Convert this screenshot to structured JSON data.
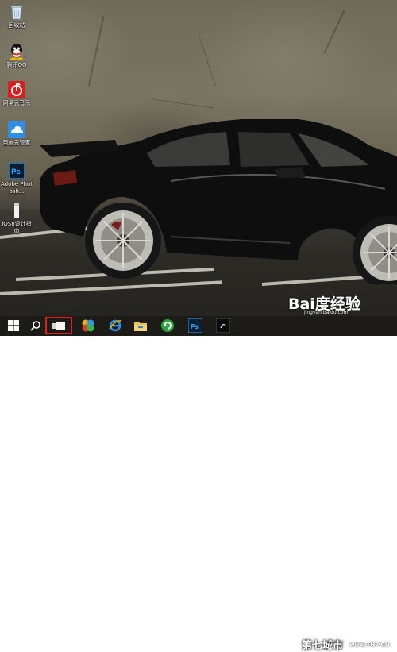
{
  "desktop": {
    "icons": [
      {
        "name": "recycle-bin-icon",
        "label": "回收站"
      },
      {
        "name": "qq-icon",
        "label": "腾讯QQ"
      },
      {
        "name": "netease-music-icon",
        "label": "网易云音乐"
      },
      {
        "name": "baidu-cloud-icon",
        "label": "百度云管家"
      },
      {
        "name": "photoshop-icon",
        "label": "Adobe Photosh..."
      },
      {
        "name": "ios8-design-file-icon",
        "label": "iOS8设计指南"
      }
    ]
  },
  "taskbar": {
    "items": [
      {
        "name": "start-windows-icon"
      },
      {
        "name": "search-icon"
      },
      {
        "name": "task-view-icon",
        "selected": true
      },
      {
        "name": "app-colorful-icon"
      },
      {
        "name": "internet-explorer-icon"
      },
      {
        "name": "file-explorer-icon"
      },
      {
        "name": "green-refresh-app-icon"
      },
      {
        "name": "photoshop-taskbar-icon",
        "label": "Ps"
      },
      {
        "name": "media-app-icon"
      }
    ],
    "selected_color": "#e0201b"
  },
  "watermarks": {
    "baidu_logo": "Bai度经验",
    "baidu_url": "jingyan.baidu.com",
    "site_cn": "第七城市",
    "site_en": "www.TH7.CN"
  },
  "colors": {
    "wallpaper_top": "#6f6a5a",
    "floor": "#2c2a25",
    "taskbar": "#1c1b18",
    "photoshop_blue": "#31a8ff"
  }
}
